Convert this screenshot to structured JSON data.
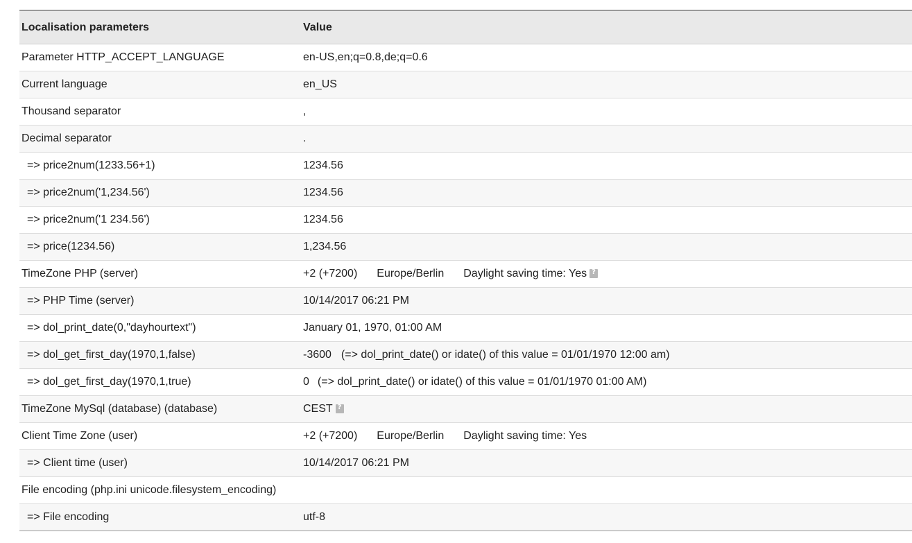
{
  "table": {
    "header": {
      "param_col": "Localisation parameters",
      "value_col": "Value"
    },
    "rows": [
      {
        "label": "Parameter HTTP_ACCEPT_LANGUAGE",
        "value": "en-US,en;q=0.8,de;q=0.6"
      },
      {
        "label": "Current language",
        "value": "en_US"
      },
      {
        "label": "Thousand separator",
        "value": ","
      },
      {
        "label": "Decimal separator",
        "value": "."
      },
      {
        "label": "=> price2num(1233.56+1)",
        "value": "1234.56"
      },
      {
        "label": "=> price2num('1,234.56')",
        "value": "1234.56"
      },
      {
        "label": "=> price2num('1 234.56')",
        "value": "1234.56"
      },
      {
        "label": "=> price(1234.56)",
        "value": "1,234.56"
      },
      {
        "label": "TimeZone PHP (server)",
        "offset": "+2 (+7200)",
        "zone": "Europe/Berlin",
        "dst": "Daylight saving time: Yes"
      },
      {
        "label": "=> PHP Time (server)",
        "value": "10/14/2017 06:21 PM"
      },
      {
        "label": "=> dol_print_date(0,\"dayhourtext\")",
        "value": "January 01, 1970, 01:00 AM"
      },
      {
        "label": "=> dol_get_first_day(1970,1,false)",
        "value": "-3600",
        "note": "(=> dol_print_date() or idate() of this value = 01/01/1970 12:00 am)"
      },
      {
        "label": "=> dol_get_first_day(1970,1,true)",
        "value": "0",
        "note": "(=> dol_print_date() or idate() of this value = 01/01/1970 01:00 AM)"
      },
      {
        "label": "TimeZone MySql (database) (database)",
        "value": "CEST"
      },
      {
        "label": "Client Time Zone (user)",
        "offset": "+2 (+7200)",
        "zone": "Europe/Berlin",
        "dst": "Daylight saving time: Yes"
      },
      {
        "label": "=> Client time (user)",
        "value": "10/14/2017 06:21 PM"
      },
      {
        "label": "File encoding (php.ini unicode.filesystem_encoding)",
        "value": ""
      },
      {
        "label": "=> File encoding",
        "value": "utf-8"
      }
    ]
  },
  "icons": {
    "help": "help-icon"
  }
}
